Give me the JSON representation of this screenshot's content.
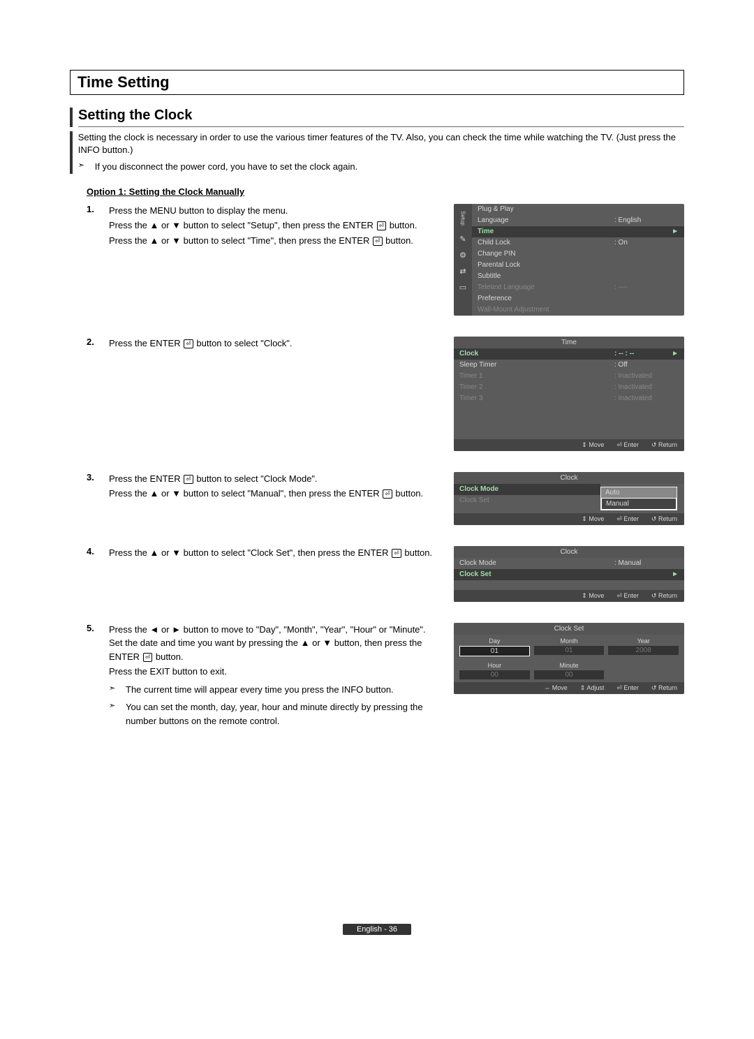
{
  "heading": "Time Setting",
  "subheading": "Setting the Clock",
  "intro": "Setting the clock is necessary in order to use the various timer features of the TV. Also, you can check the time while watching the TV. (Just press the INFO button.)",
  "intro_note": "If you disconnect the power cord, you have to set the clock again.",
  "option_title": "Option 1: Setting the Clock Manually",
  "steps": {
    "s1a": "Press the MENU button to display the menu.",
    "s1b": "Press the ▲ or ▼ button to select \"Setup\", then press the ENTER",
    "s1c": "Press the ▲ or ▼ button to select \"Time\", then press the ENTER",
    "s2": "Press the ENTER",
    "s2b": "button to select \"Clock\".",
    "s3a": "Press the ENTER",
    "s3ab": "button to select \"Clock Mode\".",
    "s3b": "Press the ▲ or ▼ button to select \"Manual\", then press the ENTER",
    "s3c": "button.",
    "s4a": "Press the ▲ or ▼ button to select \"Clock Set\", then press the ENTER",
    "s4b": "button.",
    "s5a": "Press the ◄ or ► button to move to \"Day\", \"Month\", \"Year\", \"Hour\" or \"Minute\". Set the date and time you want by pressing the ▲ or ▼ button, then press the ENTER",
    "s5a2": "button.",
    "s5b": "Press the EXIT button to exit.",
    "s5n1": "The current time will appear every time you press the INFO button.",
    "s5n2": "You can set the month, day, year, hour and minute directly by pressing the number buttons on the remote control."
  },
  "button_suffix": "button.",
  "osd1": {
    "side": "Setup",
    "items": [
      {
        "lbl": "Plug & Play",
        "val": ""
      },
      {
        "lbl": "Language",
        "val": ": English"
      },
      {
        "lbl": "Time",
        "val": "",
        "sel": true,
        "arrow": "►"
      },
      {
        "lbl": "Child Lock",
        "val": ": On"
      },
      {
        "lbl": "Change PIN",
        "val": ""
      },
      {
        "lbl": "Parental Lock",
        "val": ""
      },
      {
        "lbl": "Subtitle",
        "val": ""
      },
      {
        "lbl": "Teletext Language",
        "val": ": ----",
        "dim": true
      },
      {
        "lbl": "Preference",
        "val": ""
      },
      {
        "lbl": "Wall-Mount Adjustment",
        "val": "",
        "dim": true
      }
    ],
    "icons": [
      "✎",
      "⚙",
      "⇄",
      "▭"
    ]
  },
  "osd2": {
    "title": "Time",
    "items": [
      {
        "lbl": "Clock",
        "val": ": -- : --",
        "sel": true,
        "arrow": "►"
      },
      {
        "lbl": "Sleep Timer",
        "val": ": Off"
      },
      {
        "lbl": "Timer 1",
        "val": ": Inactivated",
        "dim": true
      },
      {
        "lbl": "Timer 2",
        "val": ": Inactivated",
        "dim": true
      },
      {
        "lbl": "Timer 3",
        "val": ": Inactivated",
        "dim": true
      }
    ]
  },
  "osd3": {
    "title": "Clock",
    "items": [
      {
        "lbl": "Clock Mode",
        "val": "",
        "sel": true
      },
      {
        "lbl": "Clock Set",
        "val": "",
        "dim": true
      }
    ],
    "popup": [
      "Auto",
      "Manual"
    ]
  },
  "osd4": {
    "title": "Clock",
    "items": [
      {
        "lbl": "Clock Mode",
        "val": ": Manual"
      },
      {
        "lbl": "Clock Set",
        "val": "",
        "sel": true,
        "arrow": "►"
      }
    ]
  },
  "osd5": {
    "title": "Clock Set",
    "row1": [
      {
        "h": "Day",
        "v": "01",
        "sel": true
      },
      {
        "h": "Month",
        "v": "01",
        "dim": true
      },
      {
        "h": "Year",
        "v": "2008",
        "dim": true
      }
    ],
    "row2": [
      {
        "h": "Hour",
        "v": "00",
        "dim": true
      },
      {
        "h": "Minute",
        "v": "00",
        "dim": true
      },
      {
        "h": "",
        "v": ""
      }
    ]
  },
  "footer_hints": {
    "move": "Move",
    "enter": "Enter",
    "return": "Return",
    "adjust": "Adjust"
  },
  "pagefoot": "English - 36"
}
